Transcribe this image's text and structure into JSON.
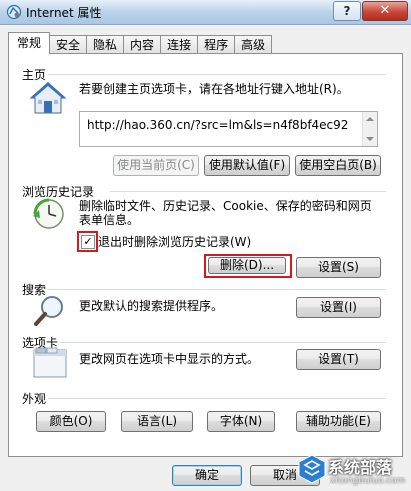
{
  "window": {
    "title": "Internet 属性",
    "help_label": "?",
    "close_label": "✕"
  },
  "tabs": [
    {
      "label": "常规",
      "active": true
    },
    {
      "label": "安全"
    },
    {
      "label": "隐私"
    },
    {
      "label": "内容"
    },
    {
      "label": "连接"
    },
    {
      "label": "程序"
    },
    {
      "label": "高级"
    }
  ],
  "homepage": {
    "section_label": "主页",
    "description": "若要创建主页选项卡，请在各地址行键入地址(R)。",
    "url": "http://hao.360.cn/?src=lm&ls=n4f8bf4ec92",
    "use_current": "使用当前页(C)",
    "use_default": "使用默认值(F)",
    "use_blank": "使用空白页(B)"
  },
  "history": {
    "section_label": "浏览历史记录",
    "description_line1": "删除临时文件、历史记录、Cookie、保存的密码和网页",
    "description_line2": "表单信息。",
    "checkbox_label": "退出时删除浏览历史记录(W)",
    "checkbox_checked": "✓",
    "delete_button": "删除(D)...",
    "settings_button": "设置(S)"
  },
  "search": {
    "section_label": "搜索",
    "description": "更改默认的搜索提供程序。",
    "settings_button": "设置(I)"
  },
  "tabs_section": {
    "section_label": "选项卡",
    "description": "更改网页在选项卡中显示的方式。",
    "settings_button": "设置(T)"
  },
  "appearance": {
    "section_label": "外观",
    "colors": "颜色(O)",
    "languages": "语言(L)",
    "fonts": "字体(N)",
    "accessibility": "辅助功能(E)"
  },
  "footer": {
    "ok": "确定",
    "cancel": "取消"
  },
  "watermark": {
    "text": "系统部落",
    "url": "xitongbuluo.com"
  },
  "colors": {
    "highlight": "#d01c1c",
    "house_blue": "#3b6fb6",
    "clock_green": "#4aa33a"
  }
}
